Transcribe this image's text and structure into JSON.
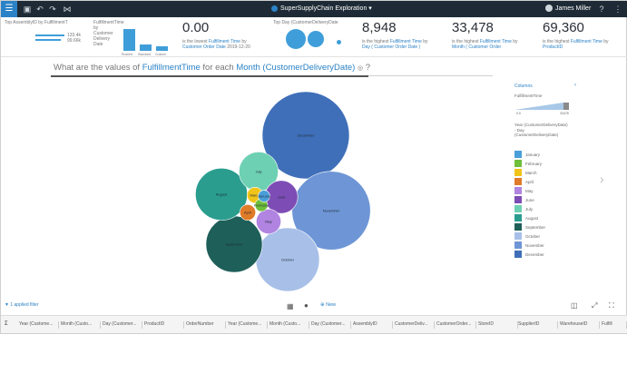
{
  "topbar": {
    "title": "SuperSupplyChain Exploration",
    "user": "James Miller",
    "icons": [
      "menu-icon",
      "save-icon",
      "undo-icon",
      "redo-icon",
      "share-icon",
      "help-icon",
      "more-icon"
    ]
  },
  "kpis": {
    "top_assembly": {
      "label": "Top AssemblyID by FulfillmentT",
      "v1": "133.4k",
      "v2": "99.66k"
    },
    "ft_by_date": {
      "label": "FulfillmentTime by Customer Delivery Date",
      "cats": [
        "Rushed",
        "Standard",
        "Custom"
      ]
    },
    "zero": {
      "value": "0.00",
      "sub_prefix": "is the lowest",
      "sub_metric": "Fulfillment Time",
      "sub_mid": "by",
      "sub_dim": "Customer Order Date",
      "sub_tail": "2019-12-20"
    },
    "top_day": {
      "label": "Top Day (CustomerDeliveryDate"
    },
    "k1": {
      "value": "8,948",
      "sub_prefix": "is the highest",
      "sub_metric": "Fulfillment Time",
      "sub_mid": "by",
      "sub_dim": "Day ( Customer Order Date )"
    },
    "k2": {
      "value": "33,478",
      "sub_prefix": "is the highest",
      "sub_metric": "Fulfillment Time",
      "sub_mid": "by",
      "sub_dim": "Month ( Customer Order"
    },
    "k3": {
      "value": "69,360",
      "sub_prefix": "is the highest",
      "sub_metric": "Fulfillment Time",
      "sub_mid": "by",
      "sub_dim": "ProductID"
    }
  },
  "question": {
    "prefix": "What are the values of",
    "metric": "FulfillmentTime",
    "mid": "for each",
    "dim": "Month (CustomerDeliveryDate)",
    "suffix": "?"
  },
  "legend": {
    "header": "Columns",
    "ft_label": "FulfillmentTime",
    "ft_min": "0.0",
    "ft_max": "33478",
    "year_caption": "Year (CustomerDeliveryDate) - Day (CustomerDeliveryDate)",
    "items": [
      {
        "label": "January",
        "color": "#4a9fd9"
      },
      {
        "label": "February",
        "color": "#6fbf3c"
      },
      {
        "label": "March",
        "color": "#f0c419"
      },
      {
        "label": "April",
        "color": "#e07b28"
      },
      {
        "label": "May",
        "color": "#b084e0"
      },
      {
        "label": "June",
        "color": "#7d4db5"
      },
      {
        "label": "July",
        "color": "#6ed0b3"
      },
      {
        "label": "August",
        "color": "#2a9d8f"
      },
      {
        "label": "September",
        "color": "#1f5f5a"
      },
      {
        "label": "October",
        "color": "#a8c0e8"
      },
      {
        "label": "November",
        "color": "#6e96d6"
      },
      {
        "label": "December",
        "color": "#3f6fb8"
      }
    ]
  },
  "chart_data": {
    "type": "bubble",
    "bubbles": [
      {
        "label": "December",
        "value": 33478,
        "color": "#3f6fb8"
      },
      {
        "label": "November",
        "value": 27200,
        "color": "#6e96d6"
      },
      {
        "label": "October",
        "value": 17800,
        "color": "#a8c0e8"
      },
      {
        "label": "September",
        "value": 14000,
        "color": "#1f5f5a"
      },
      {
        "label": "August",
        "value": 11900,
        "color": "#2a9d8f"
      },
      {
        "label": "July",
        "value": 6800,
        "color": "#6ed0b3"
      },
      {
        "label": "June",
        "value": 4800,
        "color": "#7d4db5"
      },
      {
        "label": "May",
        "value": 2700,
        "color": "#b084e0"
      },
      {
        "label": "March",
        "value": 1100,
        "color": "#f0c419"
      },
      {
        "label": "April",
        "value": 1100,
        "color": "#e07b28"
      },
      {
        "label": "February",
        "value": 700,
        "color": "#6fbf3c"
      },
      {
        "label": "January",
        "value": 600,
        "color": "#4a9fd9"
      }
    ]
  },
  "bottom": {
    "applied_filter": "1 applied filter",
    "new_label": "New"
  },
  "columns": [
    "Year (Custome...",
    "Month (Custo...",
    "Day (Customer...",
    "ProductID",
    "OrderNumber",
    "Year (Custome...",
    "Month (Custo...",
    "Day (Customer...",
    "AssemblyID",
    "CustomerDeliv...",
    "CustomerOrder...",
    "StoreID",
    "SupplierID",
    "WarehouseID",
    "Fulfill"
  ]
}
